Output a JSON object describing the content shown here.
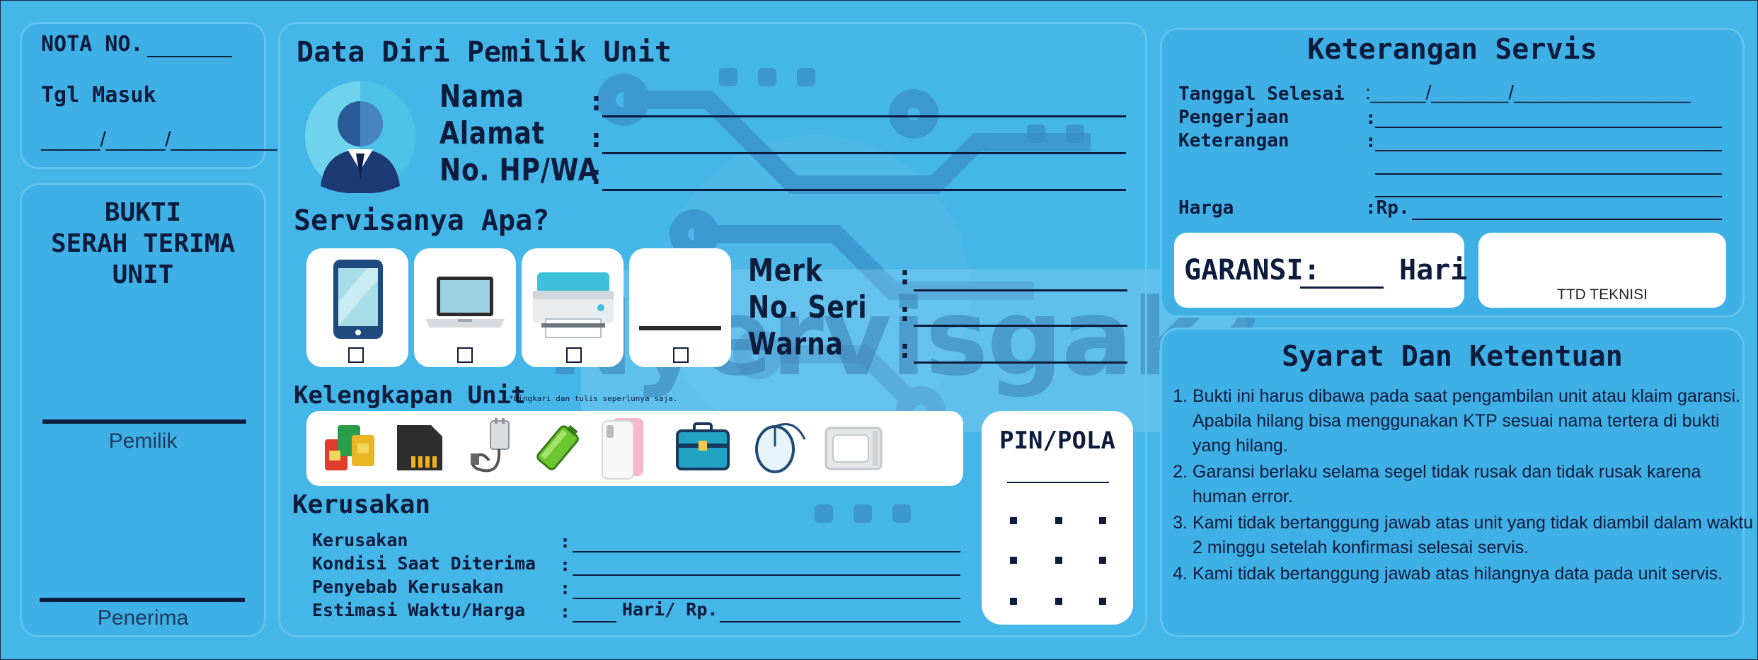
{
  "left_top": {
    "nota_label": "NOTA NO.",
    "tgl_label": "Tgl Masuk",
    "date_blank": "_____/_____/_________"
  },
  "left_bottom": {
    "title_lines": [
      "BUKTI",
      "SERAH TERIMA",
      "UNIT"
    ],
    "sign1": "Pemilik",
    "sign2": "Penerima"
  },
  "owner": {
    "title": "Data Diri Pemilik Unit",
    "fields": [
      "Nama",
      "Alamat",
      "No. HP/WA"
    ],
    "colon": ":"
  },
  "service": {
    "title": "Servisanya Apa?",
    "specs": [
      "Merk",
      "No. Seri",
      "Warna"
    ]
  },
  "accessories": {
    "title": "Kelengkapan Unit",
    "note": "*Lingkari dan tulis seperlunya saja."
  },
  "pin": {
    "title": "PIN/POLA"
  },
  "damage": {
    "title": "Kerusakan",
    "fields": [
      "Kerusakan",
      "Kondisi Saat Diterima",
      "Penyebab Kerusakan",
      "Estimasi Waktu/Harga"
    ],
    "estimate_mid": "Hari/ Rp."
  },
  "watermark": "Nyervisgak?",
  "keterangan": {
    "title": "Keterangan Servis",
    "fields": [
      "Tanggal Selesai",
      "Pengerjaan",
      "Keterangan"
    ],
    "date_blank": ":_____/_______/________________",
    "price_label": "Harga",
    "price_prefix": ":Rp.",
    "garansi_label": "GARANSI:",
    "garansi_unit": "Hari",
    "ttd": "TTD TEKNISI"
  },
  "terms": {
    "title": "Syarat Dan Ketentuan",
    "items": [
      "Bukti ini harus dibawa pada saat pengambilan unit atau klaim garansi. Apabila hilang bisa menggunakan KTP sesuai nama tertera di bukti yang hilang.",
      "Garansi berlaku selama segel tidak rusak dan tidak rusak karena human error.",
      "Kami tidak bertanggung jawab atas unit yang tidak diambil dalam waktu 2 minggu setelah konfirmasi selesai servis.",
      "Kami tidak bertanggung jawab atas hilangnya data pada unit servis."
    ]
  },
  "icons": {
    "service_devices": [
      "smartphone-icon",
      "laptop-icon",
      "printer-icon",
      "other-device-blank"
    ],
    "accessories": [
      "sim-card-icon",
      "memory-card-icon",
      "charger-icon",
      "battery-icon",
      "phone-case-icon",
      "bag-icon",
      "mouse-icon",
      "sim-tray-icon"
    ]
  },
  "colors": {
    "background": "#45b6e8",
    "panel": "#3fb0e6",
    "ink": "#0d1b3d",
    "card": "#ffffff"
  }
}
